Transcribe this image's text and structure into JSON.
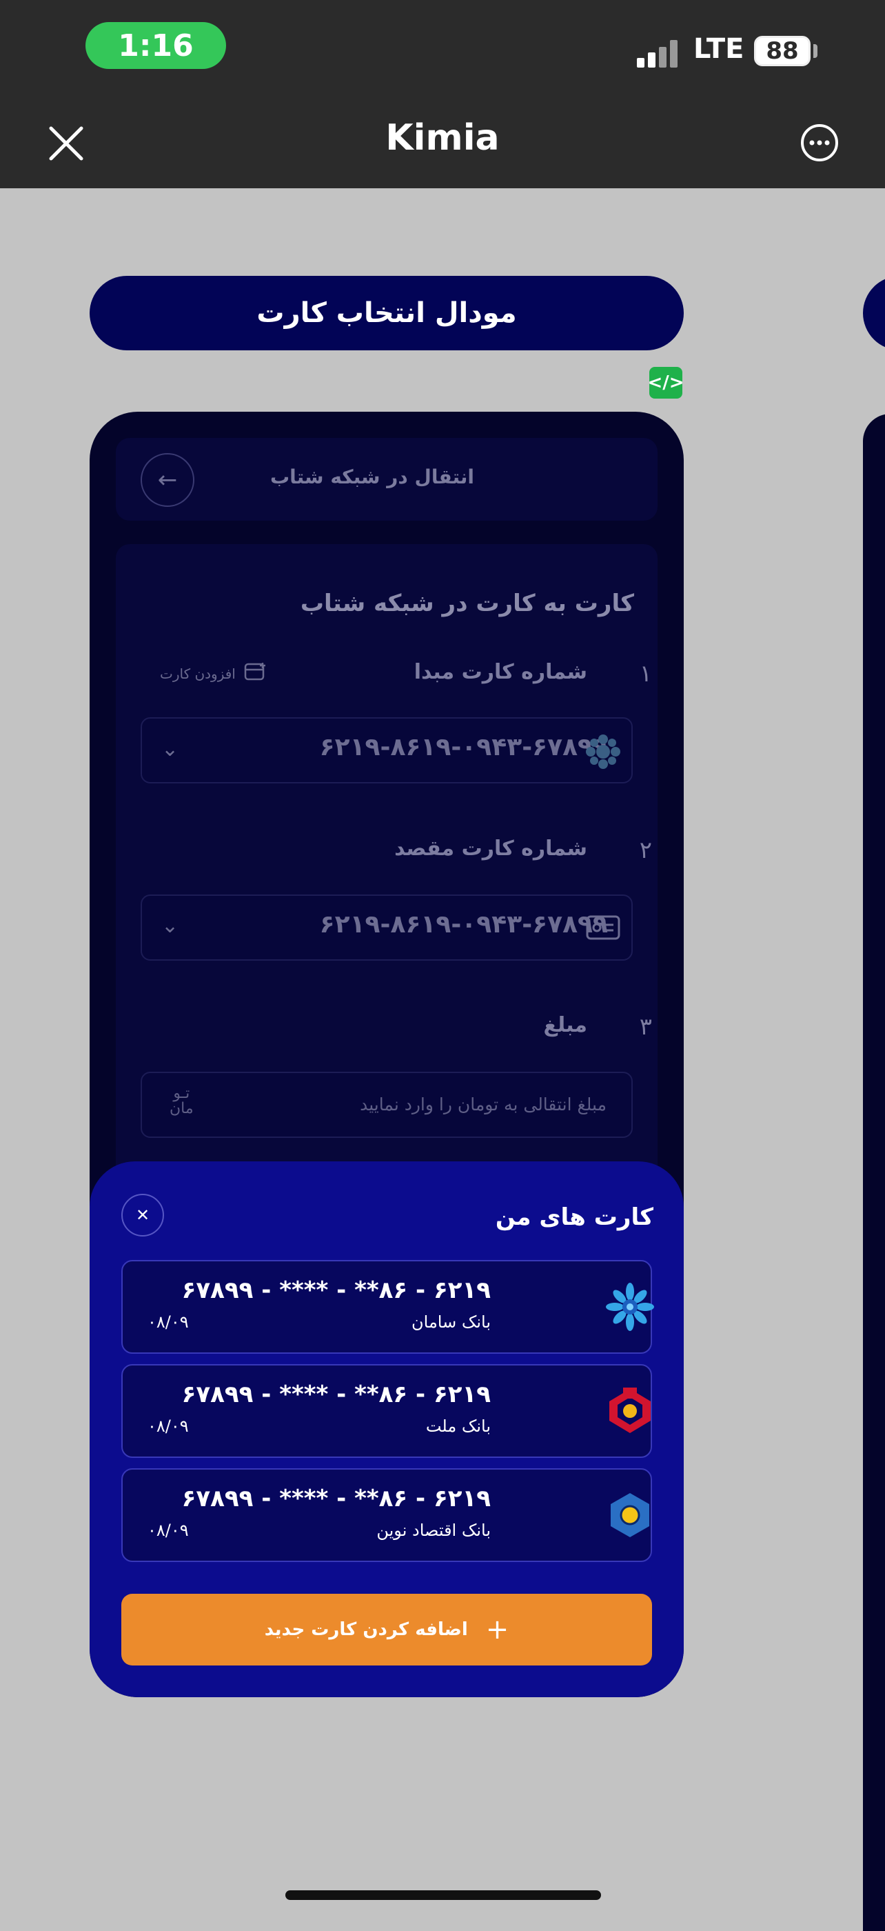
{
  "status_bar": {
    "time": "1:16",
    "network": "LTE",
    "battery": "88"
  },
  "nav": {
    "title": "Kimia"
  },
  "section_title": "مودال انتخاب کارت",
  "phone": {
    "header_title": "انتقال در شبکه شتاب",
    "form_title": "کارت به کارت در شبکه شتاب",
    "add_card_link": "افزودن کارت",
    "steps": [
      {
        "num": "۱",
        "label": "شماره کارت مبدا",
        "value": "۶۲۱۹-۸۶۱۹-۰۹۴۳-۶۷۸۹۹"
      },
      {
        "num": "۲",
        "label": "شماره کارت مقصد",
        "value": "۶۲۱۹-۸۶۱۹-۰۹۴۳-۶۷۸۹۹"
      },
      {
        "num": "۳",
        "label": "مبلغ",
        "placeholder": "مبلغ انتقالی به تومان را وارد نمایید",
        "unit_top": "تـو",
        "unit_bottom": "مان"
      }
    ]
  },
  "sheet": {
    "title": "کارت های من",
    "cards": [
      {
        "number": "۶۲۱۹ - ۸۶** - **** - ۶۷۸۹۹",
        "bank": "بانک سامان",
        "expiry": "۰۸/۰۹",
        "logo": "saman-logo"
      },
      {
        "number": "۶۲۱۹ - ۸۶** - **** - ۶۷۸۹۹",
        "bank": "بانک ملت",
        "expiry": "۰۸/۰۹",
        "logo": "mellat-logo"
      },
      {
        "number": "۶۲۱۹ - ۸۶** - **** - ۶۷۸۹۹",
        "bank": "بانک اقتصاد نوین",
        "expiry": "۰۸/۰۹",
        "logo": "eghtesad-novin-logo"
      }
    ],
    "add_button": "اضافه کردن کارت جدید"
  },
  "colors": {
    "navy": "#020456",
    "sheet": "#0c0c8e",
    "accent": "#ec8b2c",
    "status_green": "#34c759"
  }
}
